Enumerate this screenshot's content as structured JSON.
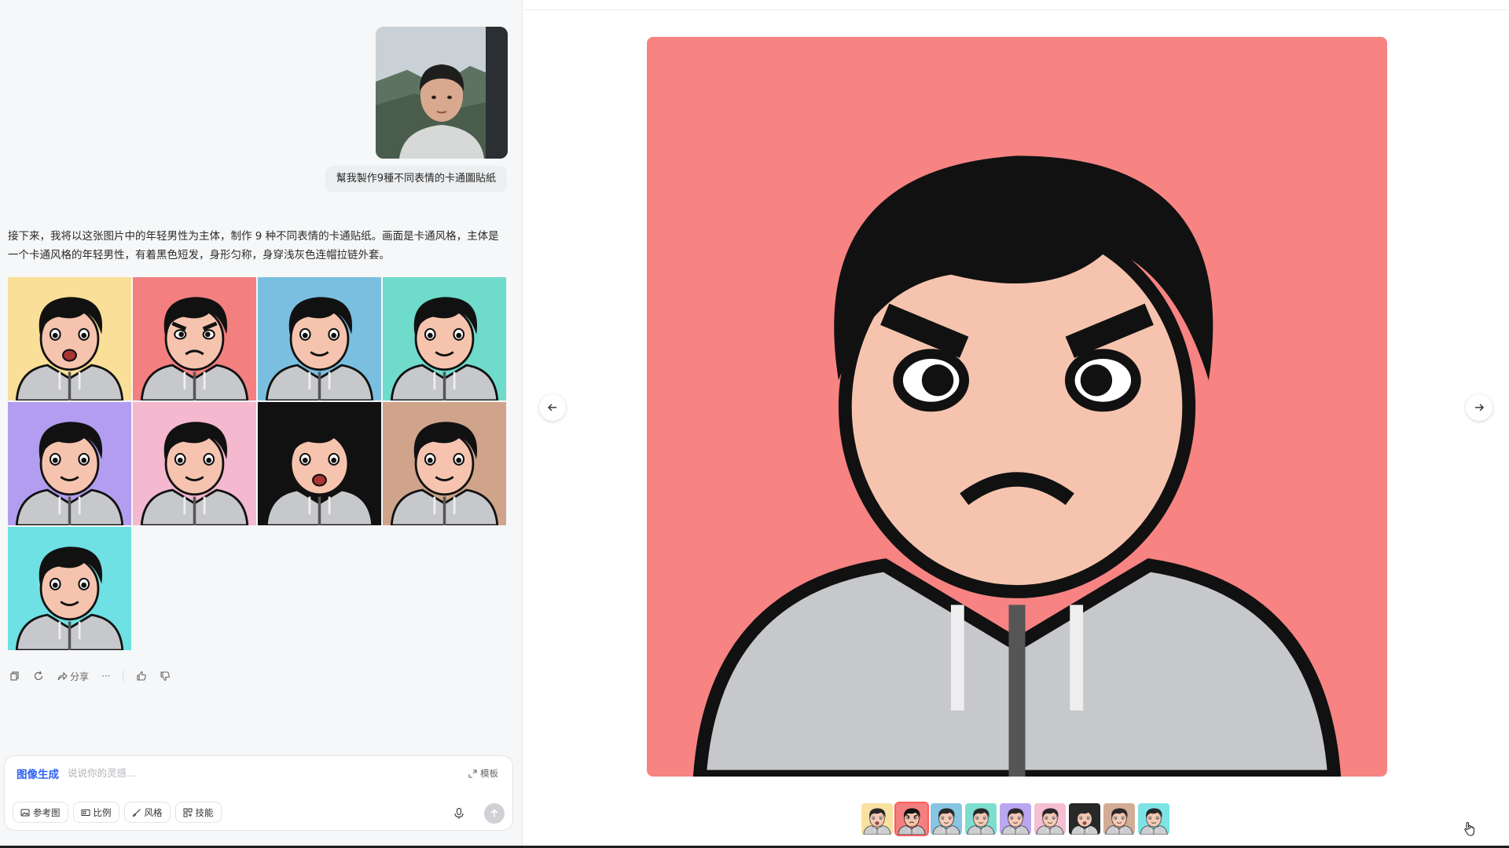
{
  "chat": {
    "user_message": "幫我製作9種不同表情的卡通圖貼紙",
    "assistant_reply": "接下来，我将以这张图片中的年轻男性为主体，制作 9 种不同表情的卡通贴纸。画面是卡通风格，主体是一个卡通风格的年轻男性，有着黑色短发，身形匀称，身穿浅灰色连帽拉链外套。",
    "stickers": [
      {
        "bg": "#f9df97"
      },
      {
        "bg": "#f37f7f"
      },
      {
        "bg": "#7bbfe0"
      },
      {
        "bg": "#6fdbca"
      },
      {
        "bg": "#b39df0"
      },
      {
        "bg": "#f4b8cf"
      },
      {
        "bg": "#111111"
      },
      {
        "bg": "#cfa48a"
      },
      {
        "bg": "#6fe0e3"
      }
    ],
    "actions": {
      "share_label": "分享",
      "more_label": "···"
    }
  },
  "composer": {
    "mode_label": "图像生成",
    "placeholder": "说说你的灵感...",
    "template_label": "模板",
    "chips": {
      "reference": "参考图",
      "ratio": "比例",
      "style": "风格",
      "skills": "技能"
    }
  },
  "viewer": {
    "active_index": 1,
    "main_bg": "#f78383"
  },
  "colors": {
    "accent": "#2d63f3",
    "hoodie": "#c7c8cb",
    "hair": "#111111",
    "skin": "#f6c4ae"
  }
}
